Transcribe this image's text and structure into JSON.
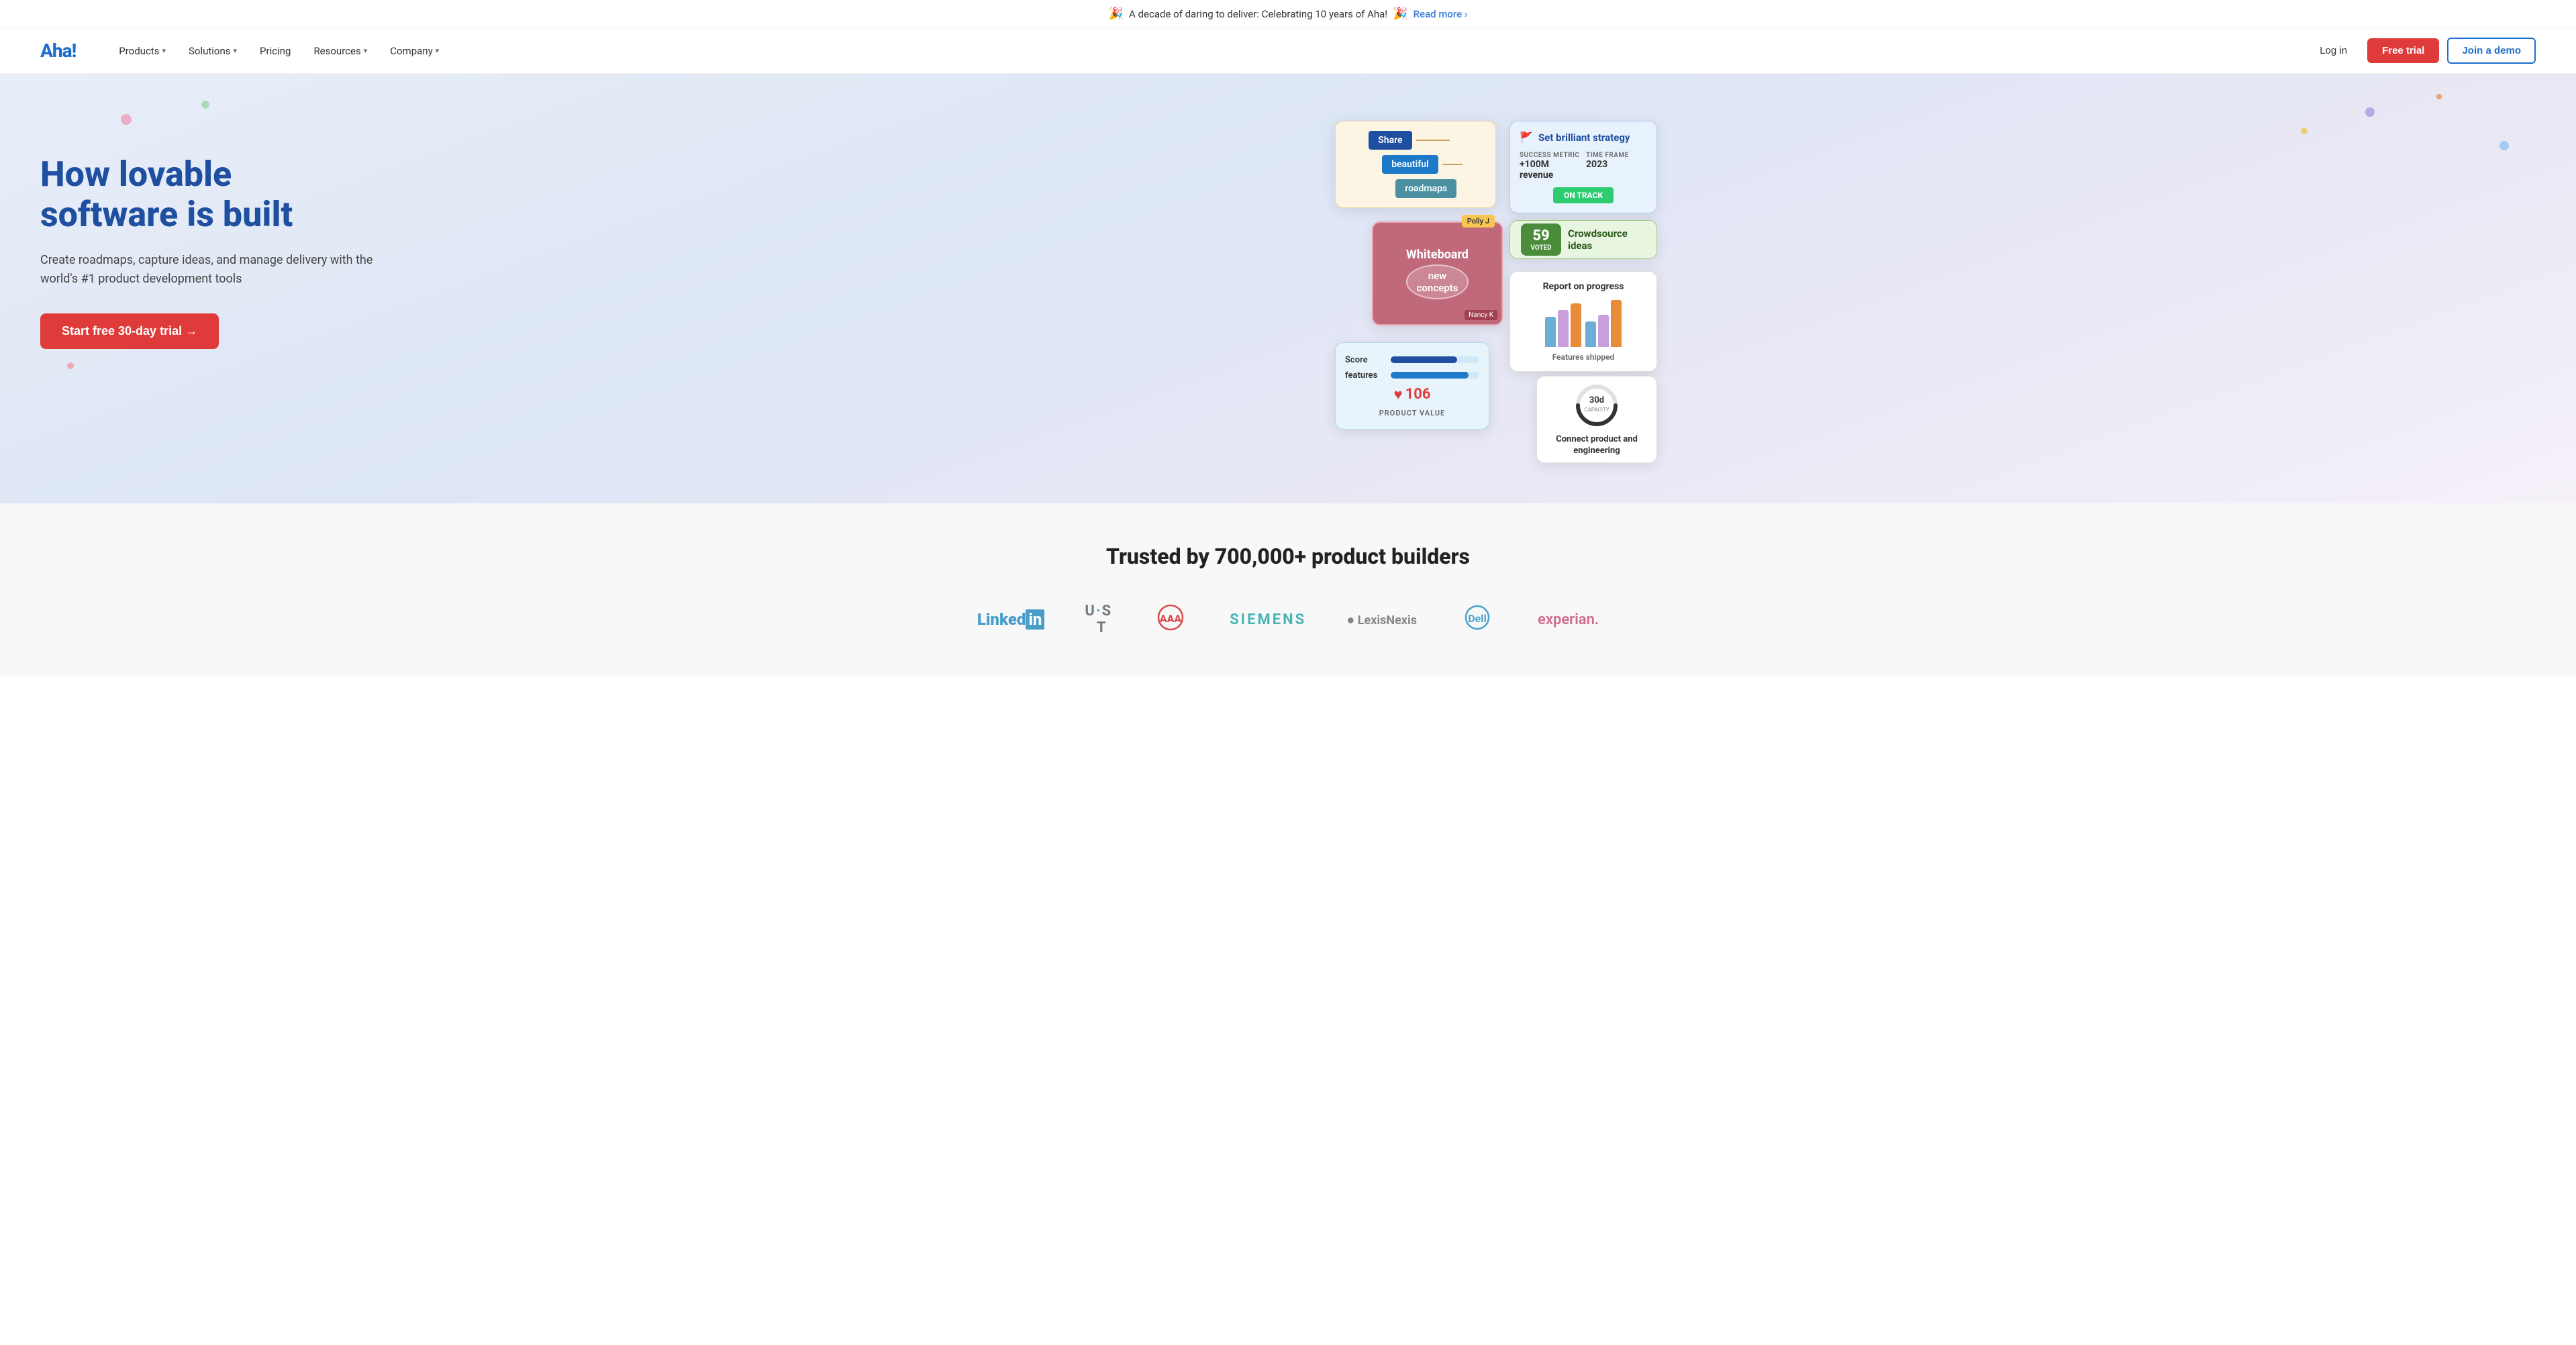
{
  "announcement": {
    "emoji_left": "🎉",
    "text": "A decade of daring to deliver: Celebrating 10 years of Aha!",
    "emoji_right": "🎉",
    "read_more_label": "Read more ›",
    "read_more_url": "#"
  },
  "nav": {
    "logo": "Aha!",
    "items": [
      {
        "label": "Products",
        "has_dropdown": true
      },
      {
        "label": "Solutions",
        "has_dropdown": true
      },
      {
        "label": "Pricing",
        "has_dropdown": false
      },
      {
        "label": "Resources",
        "has_dropdown": true
      },
      {
        "label": "Company",
        "has_dropdown": true
      }
    ],
    "login_label": "Log in",
    "free_trial_label": "Free trial",
    "join_demo_label": "Join a demo"
  },
  "hero": {
    "title_line1": "How lovable",
    "title_line2": "software is built",
    "subtitle": "Create roadmaps, capture ideas, and manage delivery with the world's #1 product development tools",
    "cta_label": "Start free 30-day trial →"
  },
  "cards": {
    "roadmap": {
      "share_label": "Share",
      "beautiful_label": "beautiful",
      "roadmaps_label": "roadmaps"
    },
    "whiteboard": {
      "polly_badge": "Polly J",
      "title": "Whiteboard",
      "new_label": "new",
      "concepts_label": "concepts",
      "nancy_label": "Nancy K"
    },
    "score": {
      "score_label": "Score",
      "features_label": "features",
      "value": "106",
      "heart_icon": "♥",
      "product_value_label": "PRODUCT VALUE"
    },
    "strategy": {
      "flag_icon": "🚩",
      "title": "Set brilliant strategy",
      "success_metric_label": "SUCCESS METRIC",
      "success_metric_value": "+100M revenue",
      "time_frame_label": "TIME FRAME",
      "time_frame_value": "2023",
      "status_label": "ON TRACK"
    },
    "ideas": {
      "voted_count": "59",
      "voted_label": "VOTED",
      "crowdsource_label": "Crowdsource ideas"
    },
    "report": {
      "title": "Report on progress",
      "subtitle": "Features shipped",
      "bars": [
        {
          "color": "#6baed6",
          "height": 45
        },
        {
          "color": "#c9a0dc",
          "height": 55
        },
        {
          "color": "#e88c3a",
          "height": 65
        },
        {
          "color": "#6baed6",
          "height": 38
        },
        {
          "color": "#c9a0dc",
          "height": 48
        },
        {
          "color": "#e88c3a",
          "height": 70
        }
      ]
    },
    "connect": {
      "days_label": "30d",
      "capacity_label": "CAPACITY",
      "description": "Connect product and engineering"
    }
  },
  "trusted": {
    "title": "Trusted by 700,000+ product builders",
    "logos": [
      {
        "name": "LinkedIn",
        "display": "LinkedIn"
      },
      {
        "name": "UST",
        "display": "U·S·T"
      },
      {
        "name": "AAA",
        "display": "AAA"
      },
      {
        "name": "Siemens",
        "display": "SIEMENS"
      },
      {
        "name": "LexisNexis",
        "display": "● LexisNexis"
      },
      {
        "name": "Dell",
        "display": "Dell"
      },
      {
        "name": "Experian",
        "display": "experian."
      }
    ]
  },
  "colors": {
    "brand_blue": "#1e4fa0",
    "brand_red": "#e03b3b",
    "accent_green": "#2ecc71"
  }
}
